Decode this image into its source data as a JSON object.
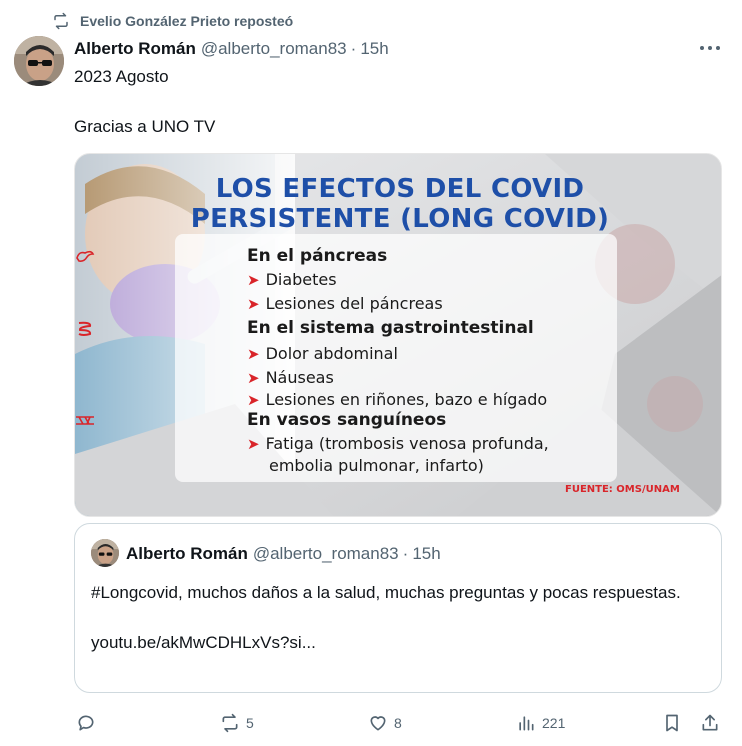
{
  "repost": {
    "icon": "repost-icon",
    "text": "Evelio González Prieto reposteó"
  },
  "tweet": {
    "author_name": "Alberto Román",
    "author_handle": "@alberto_roman83",
    "separator": "·",
    "time": "15h",
    "more_icon": "more-icon",
    "text_lines": [
      "2023 Agosto",
      "Gracias a UNO TV"
    ]
  },
  "media": {
    "title_line1": "LOS EFECTOS DEL COVID",
    "title_line2": "PERSISTENTE (LONG COVID)",
    "sections": [
      {
        "icon": "pancreas-icon",
        "heading": "En el páncreas",
        "items": [
          "Diabetes",
          "Lesiones del páncreas"
        ]
      },
      {
        "icon": "intestine-icon",
        "heading": "En el sistema gastrointestinal",
        "items": [
          "Dolor abdominal",
          "Náuseas",
          "Lesiones en riñones, bazo e hígado"
        ]
      },
      {
        "icon": "blood-vessels-icon",
        "heading": "En vasos sanguíneos",
        "items": [
          "Fatiga (trombosis venosa profunda,",
          "embolia pulmonar, infarto)"
        ]
      }
    ],
    "source": "FUENTE: OMS/UNAM",
    "colors": {
      "title": "#1e4fa8",
      "arrow": "#d9252a"
    }
  },
  "quote": {
    "author_name": "Alberto Román",
    "author_handle": "@alberto_roman83",
    "separator": "·",
    "time": "15h",
    "text": "#Longcovid, muchos daños a la salud, muchas preguntas y pocas respuestas.",
    "link": "youtu.be/akMwCDHLxVs?si..."
  },
  "actions": {
    "reply": {
      "icon": "reply-icon",
      "count": ""
    },
    "repost": {
      "icon": "repost-icon",
      "count": "5"
    },
    "like": {
      "icon": "heart-icon",
      "count": "8"
    },
    "views": {
      "icon": "views-icon",
      "count": "221"
    },
    "bookmark": {
      "icon": "bookmark-icon"
    },
    "share": {
      "icon": "share-icon"
    }
  },
  "colors": {
    "text_primary": "#0f1419",
    "text_secondary": "#536471",
    "border": "#cfd9de"
  }
}
